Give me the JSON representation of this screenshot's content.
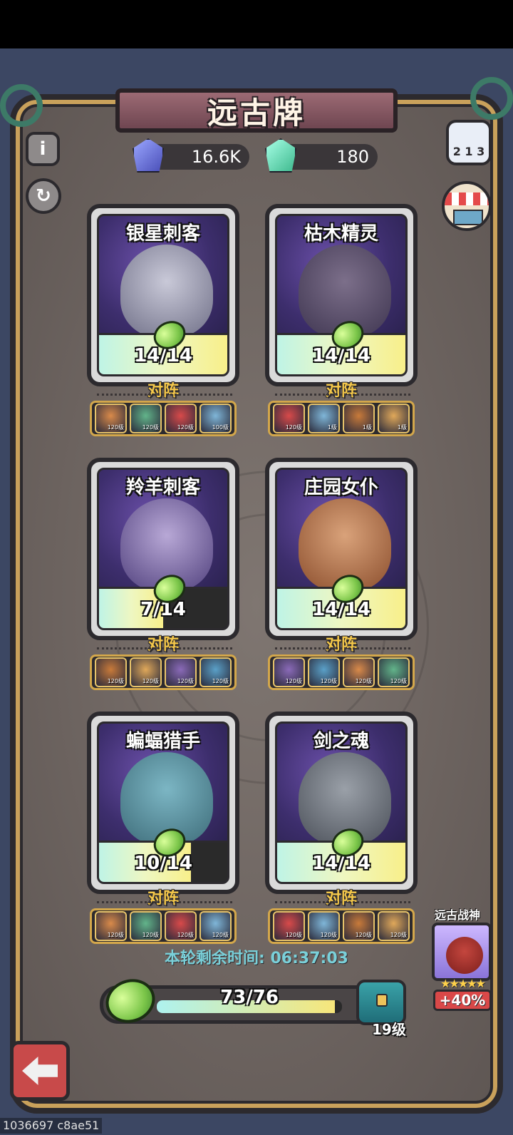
{
  "title": "远古牌",
  "currencies": [
    {
      "name": "blue-crystal",
      "value": "16.6K",
      "color": "#5a5fd0"
    },
    {
      "name": "green-crystal",
      "value": "180",
      "color": "#3fb98e"
    }
  ],
  "cards": [
    {
      "name": "银星刺客",
      "progress": "14/14",
      "fraction": 1.0,
      "vs_label": "对阵",
      "team_levels": [
        "120级",
        "120级",
        "120级",
        "100级"
      ]
    },
    {
      "name": "枯木精灵",
      "progress": "14/14",
      "fraction": 1.0,
      "vs_label": "对阵",
      "team_levels": [
        "120级",
        "1级",
        "1级",
        "1级"
      ]
    },
    {
      "name": "羚羊刺客",
      "progress": "7/14",
      "fraction": 0.5,
      "vs_label": "对阵",
      "team_levels": [
        "120级",
        "120级",
        "120级",
        "120级"
      ]
    },
    {
      "name": "庄园女仆",
      "progress": "14/14",
      "fraction": 1.0,
      "vs_label": "对阵",
      "team_levels": [
        "120级",
        "120级",
        "120级",
        "120级"
      ]
    },
    {
      "name": "蝙蝠猎手",
      "progress": "10/14",
      "fraction": 0.714,
      "vs_label": "对阵",
      "team_levels": [
        "120级",
        "120级",
        "120级",
        "120级"
      ]
    },
    {
      "name": "剑之魂",
      "progress": "14/14",
      "fraction": 1.0,
      "vs_label": "对阵",
      "team_levels": [
        "120级",
        "120级",
        "120级",
        "120级"
      ]
    }
  ],
  "timer": "本轮剩余时间: 06:37:03",
  "bottom_progress": {
    "text": "73/76",
    "fraction": 0.96
  },
  "chest_level": "19级",
  "boss": {
    "title": "远古战神",
    "stars": "★★★★★",
    "bonus": "+40%"
  },
  "footer_id": "1036697 c8ae51",
  "rank_label": "2 1 3"
}
